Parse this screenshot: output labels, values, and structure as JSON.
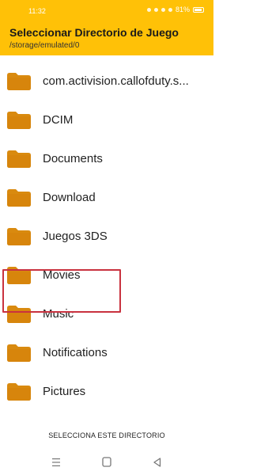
{
  "status_bar": {
    "time": "11:32",
    "battery": "81%"
  },
  "app_bar": {
    "title": "Seleccionar Directorio de Juego",
    "path": "/storage/emulated/0"
  },
  "folders": [
    {
      "label": "com.activision.callofduty.s...",
      "icon": "folder-icon"
    },
    {
      "label": "DCIM",
      "icon": "folder-icon"
    },
    {
      "label": "Documents",
      "icon": "folder-icon"
    },
    {
      "label": "Download",
      "icon": "folder-icon"
    },
    {
      "label": "Juegos 3DS",
      "icon": "folder-icon"
    },
    {
      "label": "Movies",
      "icon": "folder-icon"
    },
    {
      "label": "Music",
      "icon": "folder-icon"
    },
    {
      "label": "Notifications",
      "icon": "folder-icon"
    },
    {
      "label": "Pictures",
      "icon": "folder-icon"
    }
  ],
  "footer": {
    "select_label": "SELECCIONA ESTE DIRECTORIO"
  },
  "nav": {
    "recents": "menu-icon",
    "home": "square-home-icon",
    "back": "triangle-back-icon"
  },
  "colors": {
    "accent": "#ffc107",
    "folder": "#d98a0f",
    "highlight": "#c9323f"
  }
}
